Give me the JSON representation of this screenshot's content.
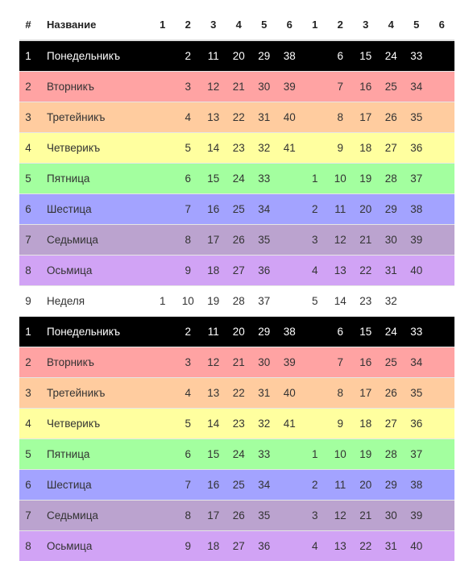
{
  "header": {
    "num": "#",
    "name": "Название",
    "cols": [
      "1",
      "2",
      "3",
      "4",
      "5",
      "6",
      "1",
      "2",
      "3",
      "4",
      "5",
      "6"
    ]
  },
  "colors": {
    "black": "#000000",
    "red": "#ffa3a3",
    "orange": "#ffcc9f",
    "yellow": "#ffff9f",
    "green": "#a3ff9f",
    "blue": "#a3a3ff",
    "purple": "#bba3cf",
    "violet": "#d1a3f5",
    "white": "#ffffff"
  },
  "rows": [
    {
      "num": "1",
      "name": "Понедельникъ",
      "color": "black",
      "cells": [
        "",
        "2",
        "11",
        "20",
        "29",
        "38",
        "",
        "6",
        "15",
        "24",
        "33",
        ""
      ]
    },
    {
      "num": "2",
      "name": "Вторникъ",
      "color": "red",
      "cells": [
        "",
        "3",
        "12",
        "21",
        "30",
        "39",
        "",
        "7",
        "16",
        "25",
        "34",
        ""
      ]
    },
    {
      "num": "3",
      "name": "Третейникъ",
      "color": "orange",
      "cells": [
        "",
        "4",
        "13",
        "22",
        "31",
        "40",
        "",
        "8",
        "17",
        "26",
        "35",
        ""
      ]
    },
    {
      "num": "4",
      "name": "Четверикъ",
      "color": "yellow",
      "cells": [
        "",
        "5",
        "14",
        "23",
        "32",
        "41",
        "",
        "9",
        "18",
        "27",
        "36",
        ""
      ]
    },
    {
      "num": "5",
      "name": "Пятница",
      "color": "green",
      "cells": [
        "",
        "6",
        "15",
        "24",
        "33",
        "",
        "1",
        "10",
        "19",
        "28",
        "37",
        ""
      ]
    },
    {
      "num": "6",
      "name": "Шестица",
      "color": "blue",
      "cells": [
        "",
        "7",
        "16",
        "25",
        "34",
        "",
        "2",
        "11",
        "20",
        "29",
        "38",
        ""
      ]
    },
    {
      "num": "7",
      "name": "Седьмица",
      "color": "purple",
      "cells": [
        "",
        "8",
        "17",
        "26",
        "35",
        "",
        "3",
        "12",
        "21",
        "30",
        "39",
        ""
      ]
    },
    {
      "num": "8",
      "name": "Осьмица",
      "color": "violet",
      "cells": [
        "",
        "9",
        "18",
        "27",
        "36",
        "",
        "4",
        "13",
        "22",
        "31",
        "40",
        ""
      ]
    },
    {
      "num": "9",
      "name": "Неделя",
      "color": "white",
      "cells": [
        "1",
        "10",
        "19",
        "28",
        "37",
        "",
        "5",
        "14",
        "23",
        "32",
        "",
        ""
      ]
    },
    {
      "num": "1",
      "name": "Понедельникъ",
      "color": "black",
      "cells": [
        "",
        "2",
        "11",
        "20",
        "29",
        "38",
        "",
        "6",
        "15",
        "24",
        "33",
        ""
      ]
    },
    {
      "num": "2",
      "name": "Вторникъ",
      "color": "red",
      "cells": [
        "",
        "3",
        "12",
        "21",
        "30",
        "39",
        "",
        "7",
        "16",
        "25",
        "34",
        ""
      ]
    },
    {
      "num": "3",
      "name": "Третейникъ",
      "color": "orange",
      "cells": [
        "",
        "4",
        "13",
        "22",
        "31",
        "40",
        "",
        "8",
        "17",
        "26",
        "35",
        ""
      ]
    },
    {
      "num": "4",
      "name": "Четверикъ",
      "color": "yellow",
      "cells": [
        "",
        "5",
        "14",
        "23",
        "32",
        "41",
        "",
        "9",
        "18",
        "27",
        "36",
        ""
      ]
    },
    {
      "num": "5",
      "name": "Пятница",
      "color": "green",
      "cells": [
        "",
        "6",
        "15",
        "24",
        "33",
        "",
        "1",
        "10",
        "19",
        "28",
        "37",
        ""
      ]
    },
    {
      "num": "6",
      "name": "Шестица",
      "color": "blue",
      "cells": [
        "",
        "7",
        "16",
        "25",
        "34",
        "",
        "2",
        "11",
        "20",
        "29",
        "38",
        ""
      ]
    },
    {
      "num": "7",
      "name": "Седьмица",
      "color": "purple",
      "cells": [
        "",
        "8",
        "17",
        "26",
        "35",
        "",
        "3",
        "12",
        "21",
        "30",
        "39",
        ""
      ]
    },
    {
      "num": "8",
      "name": "Осьмица",
      "color": "violet",
      "cells": [
        "",
        "9",
        "18",
        "27",
        "36",
        "",
        "4",
        "13",
        "22",
        "31",
        "40",
        ""
      ]
    }
  ]
}
